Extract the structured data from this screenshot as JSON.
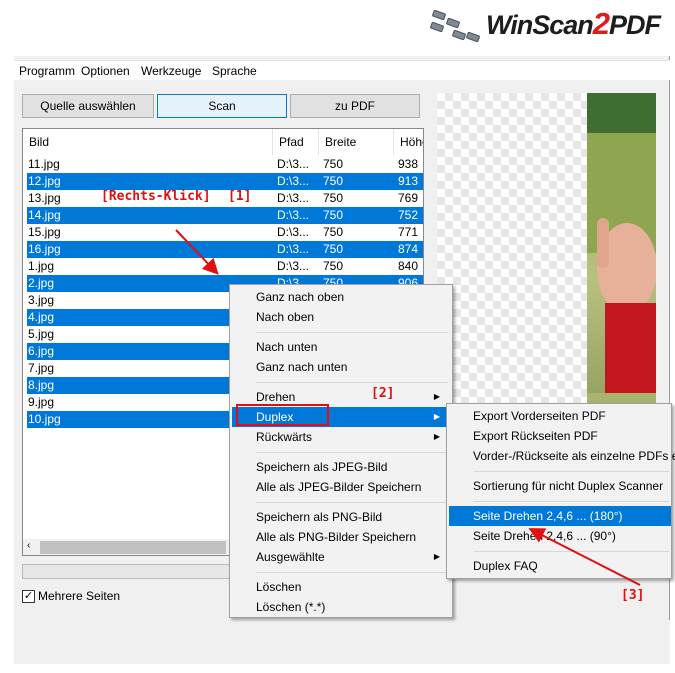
{
  "app": {
    "logo_main": "WinScan",
    "logo_two": "2",
    "logo_end": "PDF"
  },
  "menubar": [
    "Programm",
    "Optionen",
    "Werkzeuge",
    "Sprache"
  ],
  "buttons": {
    "source": "Quelle auswählen",
    "scan": "Scan",
    "to_pdf": "zu PDF"
  },
  "table": {
    "headers": [
      "Bild",
      "Pfad",
      "Breite",
      "Höhe"
    ],
    "rows": [
      {
        "name": "11.jpg",
        "path": "D:\\3...",
        "width": "750",
        "height": "938",
        "selected": false
      },
      {
        "name": "12.jpg",
        "path": "D:\\3...",
        "width": "750",
        "height": "913",
        "selected": true
      },
      {
        "name": "13.jpg",
        "path": "D:\\3...",
        "width": "750",
        "height": "769",
        "selected": false
      },
      {
        "name": "14.jpg",
        "path": "D:\\3...",
        "width": "750",
        "height": "752",
        "selected": true
      },
      {
        "name": "15.jpg",
        "path": "D:\\3...",
        "width": "750",
        "height": "771",
        "selected": false
      },
      {
        "name": "16.jpg",
        "path": "D:\\3...",
        "width": "750",
        "height": "874",
        "selected": true
      },
      {
        "name": "1.jpg",
        "path": "D:\\3...",
        "width": "750",
        "height": "840",
        "selected": false
      },
      {
        "name": "2.jpg",
        "path": "D:\\3...",
        "width": "750",
        "height": "906",
        "selected": true
      },
      {
        "name": "3.jpg",
        "path": "",
        "width": "",
        "height": "",
        "selected": false
      },
      {
        "name": "4.jpg",
        "path": "",
        "width": "",
        "height": "",
        "selected": true
      },
      {
        "name": "5.jpg",
        "path": "",
        "width": "",
        "height": "",
        "selected": false
      },
      {
        "name": "6.jpg",
        "path": "",
        "width": "",
        "height": "",
        "selected": true
      },
      {
        "name": "7.jpg",
        "path": "",
        "width": "",
        "height": "",
        "selected": false
      },
      {
        "name": "8.jpg",
        "path": "",
        "width": "",
        "height": "",
        "selected": true
      },
      {
        "name": "9.jpg",
        "path": "",
        "width": "",
        "height": "",
        "selected": false
      },
      {
        "name": "10.jpg",
        "path": "",
        "width": "",
        "height": "",
        "selected": true
      }
    ]
  },
  "multi_page_label": "Mehrere Seiten",
  "context_menu": {
    "items": [
      "Ganz nach oben",
      "Nach oben",
      "Nach unten",
      "Ganz nach unten",
      "Drehen",
      "Duplex",
      "Rückwärts",
      "Speichern als JPEG-Bild",
      "Alle als JPEG-Bilder Speichern",
      "Speichern als PNG-Bild",
      "Alle als PNG-Bilder Speichern",
      "Ausgewählte",
      "Löschen",
      "Löschen (*.*)"
    ]
  },
  "submenu": {
    "items": [
      "Export Vorderseiten PDF",
      "Export Rückseiten PDF",
      "Vorder-/Rückseite als einzelne PDFs e",
      "Sortierung für nicht Duplex Scanner",
      "Seite Drehen 2,4,6 ... (180°)",
      "Seite Drehen 2,4,6 ... (90°)",
      "Duplex FAQ"
    ]
  },
  "annotations": {
    "right_click": "[Rechts-Klick]",
    "n1": "[1]",
    "n2": "[2]",
    "n3": "[3]"
  },
  "colors": {
    "selection": "#0078d7",
    "annotation": "#e01010"
  }
}
